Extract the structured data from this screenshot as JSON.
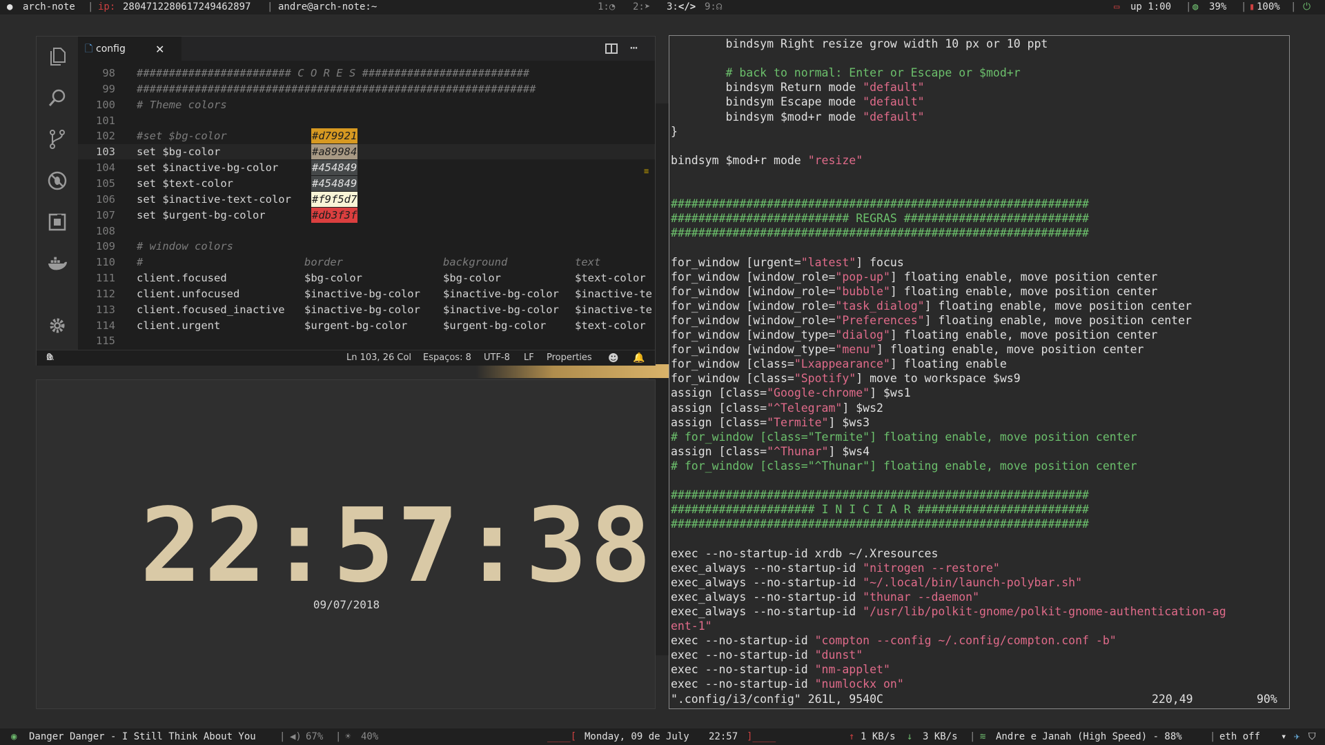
{
  "topbar": {
    "host": "arch-note",
    "ip_label": "ip:",
    "ip_value": "2804712280617249462897",
    "user": "andre@arch-note:~",
    "ws1": "1:",
    "ws2": "2:",
    "ws3": "3:",
    "ws9": "9:",
    "uptime": "up 1:00",
    "cpu": "39%",
    "battery": "100%"
  },
  "vscode": {
    "tab_label": "config",
    "lines": [
      {
        "n": "98",
        "html": "######################## C O R E S ##########################",
        "cls": "cm"
      },
      {
        "n": "99",
        "html": "##############################################################",
        "cls": "cm"
      },
      {
        "n": "100",
        "html": "# Theme colors",
        "cls": "cm"
      },
      {
        "n": "101",
        "html": "",
        "cls": ""
      },
      {
        "n": "102",
        "pre": "#set $bg-color",
        "cls": "cm",
        "sw": "#d79921",
        "swbg": "#d79921",
        "swfg": "#1e1e1e"
      },
      {
        "n": "103",
        "pre": "set $bg-color",
        "cls": "",
        "sw": "#a89984",
        "swbg": "#a89984",
        "swfg": "#1e1e1e"
      },
      {
        "n": "104",
        "pre": "set $inactive-bg-color",
        "cls": "",
        "sw": "#454849",
        "swbg": "#454849",
        "swfg": "#e0e0e0"
      },
      {
        "n": "105",
        "pre": "set $text-color",
        "cls": "",
        "sw": "#454849",
        "swbg": "#454849",
        "swfg": "#e0e0e0"
      },
      {
        "n": "106",
        "pre": "set $inactive-text-color",
        "cls": "",
        "sw": "#f9f5d7",
        "swbg": "#f9f5d7",
        "swfg": "#1e1e1e"
      },
      {
        "n": "107",
        "pre": "set $urgent-bg-color",
        "cls": "",
        "sw": "#db3f3f",
        "swbg": "#db3f3f",
        "swfg": "#1e1e1e"
      },
      {
        "n": "108",
        "html": "",
        "cls": ""
      },
      {
        "n": "109",
        "html": "# window colors",
        "cls": "cm"
      },
      {
        "n": "110",
        "cols": [
          "#",
          "border",
          "background",
          "text"
        ],
        "cls": "cm"
      },
      {
        "n": "111",
        "cols": [
          "client.focused",
          "$bg-color",
          "$bg-color",
          "$text-color"
        ],
        "cls": ""
      },
      {
        "n": "112",
        "cols": [
          "client.unfocused",
          "$inactive-bg-color",
          "$inactive-bg-color",
          "$inactive-te"
        ],
        "cls": ""
      },
      {
        "n": "113",
        "cols": [
          "client.focused_inactive",
          "$inactive-bg-color",
          "$inactive-bg-color",
          "$inactive-te"
        ],
        "cls": ""
      },
      {
        "n": "114",
        "cols": [
          "client.urgent",
          "$urgent-bg-color",
          "$urgent-bg-color",
          "$text-color"
        ],
        "cls": ""
      },
      {
        "n": "115",
        "html": "",
        "cls": ""
      }
    ],
    "status": {
      "errors": "0",
      "warnings": "0",
      "position": "Ln 103, 26 Col",
      "spaces": "Espaços: 8",
      "encoding": "UTF-8",
      "eol": "LF",
      "language": "Properties"
    }
  },
  "clock": {
    "time": "22:57:38",
    "date": "09/07/2018"
  },
  "vim": {
    "lines": [
      [
        [
          "        bindsym Right resize grow width 10 px or 10 ppt",
          ""
        ]
      ],
      [
        [
          "",
          ""
        ]
      ],
      [
        [
          "        # back to normal: Enter or Escape or $mod+r",
          "vc"
        ]
      ],
      [
        [
          "        bindsym Return mode ",
          ""
        ],
        [
          "\"default\"",
          "vs"
        ]
      ],
      [
        [
          "        bindsym Escape mode ",
          ""
        ],
        [
          "\"default\"",
          "vs"
        ]
      ],
      [
        [
          "        bindsym $mod+r mode ",
          ""
        ],
        [
          "\"default\"",
          "vs"
        ]
      ],
      [
        [
          "}",
          ""
        ]
      ],
      [
        [
          "",
          ""
        ]
      ],
      [
        [
          "bindsym $mod+r mode ",
          ""
        ],
        [
          "\"resize\"",
          "vs"
        ]
      ],
      [
        [
          "",
          ""
        ]
      ],
      [
        [
          "",
          ""
        ]
      ],
      [
        [
          "#############################################################",
          "vh"
        ]
      ],
      [
        [
          "########################## REGRAS ###########################",
          "vh"
        ]
      ],
      [
        [
          "#############################################################",
          "vh"
        ]
      ],
      [
        [
          "",
          ""
        ]
      ],
      [
        [
          "for_window [urgent=",
          ""
        ],
        [
          "\"latest\"",
          "vs"
        ],
        [
          "] focus",
          ""
        ]
      ],
      [
        [
          "for_window [window_role=",
          ""
        ],
        [
          "\"pop-up\"",
          "vs"
        ],
        [
          "] floating enable, move position center",
          ""
        ]
      ],
      [
        [
          "for_window [window_role=",
          ""
        ],
        [
          "\"bubble\"",
          "vs"
        ],
        [
          "] floating enable, move position center",
          ""
        ]
      ],
      [
        [
          "for_window [window_role=",
          ""
        ],
        [
          "\"task_dialog\"",
          "vs"
        ],
        [
          "] floating enable, move position center",
          ""
        ]
      ],
      [
        [
          "for_window [window_role=",
          ""
        ],
        [
          "\"Preferences\"",
          "vs"
        ],
        [
          "] floating enable, move position center",
          ""
        ]
      ],
      [
        [
          "for_window [window_type=",
          ""
        ],
        [
          "\"dialog\"",
          "vs"
        ],
        [
          "] floating enable, move position center",
          ""
        ]
      ],
      [
        [
          "for_window [window_type=",
          ""
        ],
        [
          "\"menu\"",
          "vs"
        ],
        [
          "] floating enable, move position center",
          ""
        ]
      ],
      [
        [
          "for_window [class=",
          ""
        ],
        [
          "\"Lxappearance\"",
          "vs"
        ],
        [
          "] floating enable",
          ""
        ]
      ],
      [
        [
          "for_window [class=",
          ""
        ],
        [
          "\"Spotify\"",
          "vs"
        ],
        [
          "] move to workspace $ws9",
          ""
        ]
      ],
      [
        [
          "assign [class=",
          ""
        ],
        [
          "\"Google-chrome\"",
          "vs"
        ],
        [
          "] $ws1",
          ""
        ]
      ],
      [
        [
          "assign [class=",
          ""
        ],
        [
          "\"^Telegram\"",
          "vs"
        ],
        [
          "] $ws2",
          ""
        ]
      ],
      [
        [
          "assign [class=",
          ""
        ],
        [
          "\"Termite\"",
          "vs"
        ],
        [
          "] $ws3",
          ""
        ]
      ],
      [
        [
          "# for_window [class=\"Termite\"] floating enable, move position center",
          "vc"
        ]
      ],
      [
        [
          "assign [class=",
          ""
        ],
        [
          "\"^Thunar\"",
          "vs"
        ],
        [
          "] $ws4",
          ""
        ]
      ],
      [
        [
          "# for_window [class=\"^Thunar\"] floating enable, move position center",
          "vc"
        ]
      ],
      [
        [
          "",
          ""
        ]
      ],
      [
        [
          "#############################################################",
          "vh"
        ]
      ],
      [
        [
          "##################### I N I C I A R #########################",
          "vh"
        ]
      ],
      [
        [
          "#############################################################",
          "vh"
        ]
      ],
      [
        [
          "",
          ""
        ]
      ],
      [
        [
          "exec --no-startup-id xrdb ~/.Xresources",
          ""
        ]
      ],
      [
        [
          "exec_always --no-startup-id ",
          ""
        ],
        [
          "\"nitrogen --restore\"",
          "vs"
        ]
      ],
      [
        [
          "exec_always --no-startup-id ",
          ""
        ],
        [
          "\"~/.local/bin/launch-polybar.sh\"",
          "vs"
        ]
      ],
      [
        [
          "exec_always --no-startup-id ",
          ""
        ],
        [
          "\"thunar --daemon\"",
          "vs"
        ]
      ],
      [
        [
          "exec_always --no-startup-id ",
          ""
        ],
        [
          "\"/usr/lib/polkit-gnome/polkit-gnome-authentication-ag",
          "vs"
        ]
      ],
      [
        [
          "ent-1\"",
          "vs"
        ]
      ],
      [
        [
          "exec --no-startup-id ",
          ""
        ],
        [
          "\"compton --config ~/.config/compton.conf -b\"",
          "vs"
        ]
      ],
      [
        [
          "exec --no-startup-id ",
          ""
        ],
        [
          "\"dunst\"",
          "vs"
        ]
      ],
      [
        [
          "exec --no-startup-id ",
          ""
        ],
        [
          "\"nm-applet\"",
          "vs"
        ]
      ],
      [
        [
          "exec --no-startup-id ",
          ""
        ],
        [
          "\"numlockx on\"",
          "vs"
        ]
      ]
    ],
    "statusline_file": "\".config/i3/config\" 261L, 9540C",
    "statusline_pos": "220,49",
    "statusline_pct": "90%"
  },
  "bottombar": {
    "song": "Danger Danger - I Still Think About You",
    "volume": "67%",
    "brightness": "40%",
    "date": "Monday, 09 de July",
    "time": "22:57",
    "up_speed": "1 KB/s",
    "down_speed": "3 KB/s",
    "wifi": "Andre e Janah (High Speed) - 88%",
    "eth": "eth off"
  }
}
